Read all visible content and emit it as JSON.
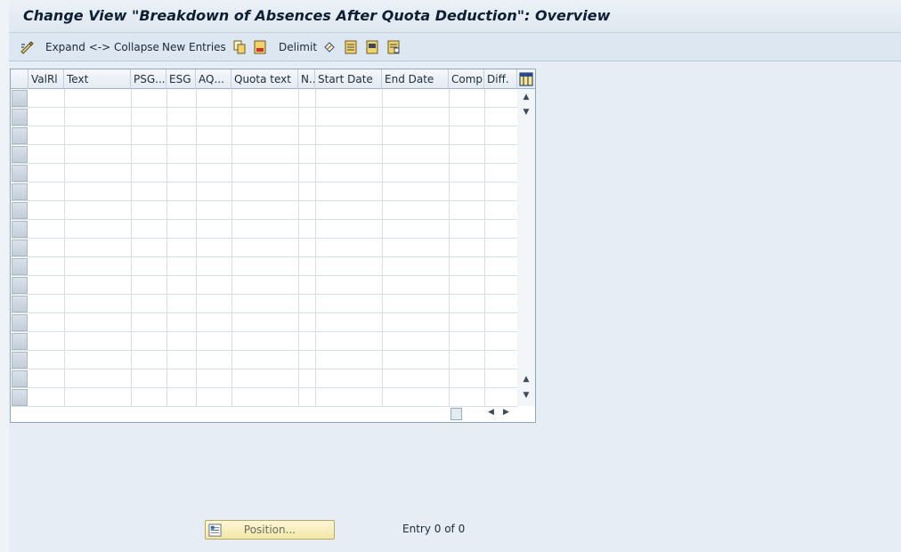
{
  "window": {
    "title": "Change View \"Breakdown of Absences After Quota Deduction\": Overview"
  },
  "toolbar": {
    "expand_collapse_label": "Expand <-> Collapse",
    "new_entries_label": "New Entries",
    "delimit_label": "Delimit",
    "icons": [
      "display-change-icon",
      "copy-icon",
      "delete-icon",
      "undo-icon",
      "select-all-icon",
      "select-block-icon",
      "deselect-all-icon"
    ]
  },
  "table": {
    "columns": [
      "ValRl",
      "Text",
      "PSG...",
      "ESG",
      "AQ...",
      "Quota text",
      "N..",
      "Start Date",
      "End Date",
      "Comp.",
      "Diff."
    ],
    "row_count": 17,
    "config_icon": "table-settings-icon"
  },
  "footer": {
    "position_label": "Position...",
    "entry_text": "Entry 0 of 0"
  }
}
